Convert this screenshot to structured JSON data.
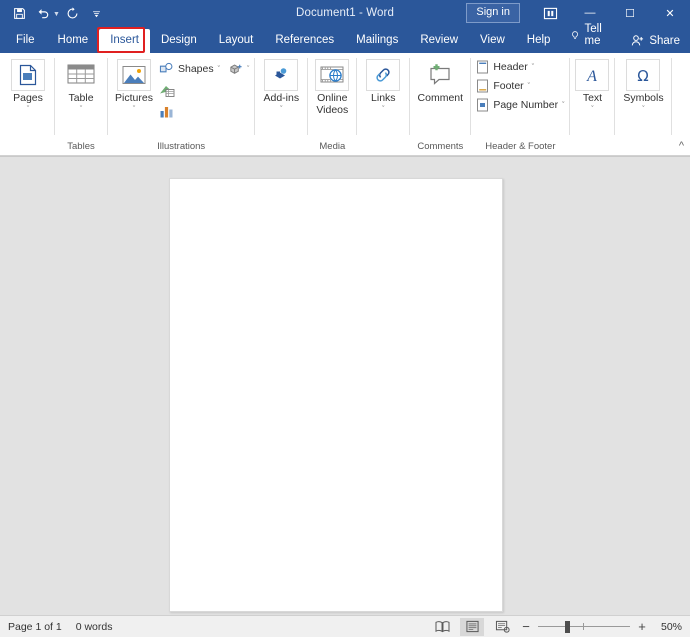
{
  "titlebar": {
    "document_title": "Document1  -  Word",
    "quick_access": [
      {
        "name": "save",
        "icon": "save-icon"
      },
      {
        "name": "undo",
        "icon": "undo-icon"
      },
      {
        "name": "redo",
        "icon": "redo-icon"
      },
      {
        "name": "customize-quick-access-toolbar",
        "icon": "caret-down-icon"
      }
    ],
    "sign_in_label": "Sign in",
    "ribbon_display_options": "ribbon-display-options-icon",
    "minimize_label": "—",
    "maximize_label": "☐",
    "close_label": "✕"
  },
  "tabs": [
    {
      "label": "File",
      "active": false
    },
    {
      "label": "Home",
      "active": false
    },
    {
      "label": "Insert",
      "active": true,
      "highlighted": true
    },
    {
      "label": "Design",
      "active": false
    },
    {
      "label": "Layout",
      "active": false
    },
    {
      "label": "References",
      "active": false
    },
    {
      "label": "Mailings",
      "active": false
    },
    {
      "label": "Review",
      "active": false
    },
    {
      "label": "View",
      "active": false
    },
    {
      "label": "Help",
      "active": false
    }
  ],
  "tellme_label": "Tell me",
  "share_label": "Share",
  "highlight_color": "#e02020",
  "accent_color": "#2b579a",
  "ribbon": {
    "groups": [
      {
        "label": "",
        "buttons": [
          {
            "label": "Pages",
            "caret": "ˇ",
            "icon": "cover-page-icon"
          }
        ]
      },
      {
        "label": "Tables",
        "buttons": [
          {
            "label": "Table",
            "caret": "ˇ",
            "icon": "table-icon"
          }
        ]
      },
      {
        "label": "Illustrations",
        "buttons": [
          {
            "label": "Pictures",
            "caret": "ˇ",
            "icon": "pictures-icon"
          }
        ],
        "small_buttons": [
          {
            "label": "Shapes",
            "caret": "ˇ",
            "icon": "shapes-icon"
          },
          {
            "label": "",
            "caret": "ˇ",
            "icon": "3d-models-icon"
          },
          {
            "label": "",
            "caret": "",
            "icon": "smartart-icon"
          },
          {
            "label": "",
            "caret": "",
            "icon": "chart-icon"
          }
        ]
      },
      {
        "label": "",
        "buttons": [
          {
            "label": "Add-ins",
            "caret": "ˇ",
            "icon": "add-ins-icon"
          }
        ]
      },
      {
        "label": "Media",
        "buttons": [
          {
            "label": "Online Videos",
            "caret": "",
            "icon": "online-videos-icon"
          }
        ]
      },
      {
        "label": "",
        "buttons": [
          {
            "label": "Links",
            "caret": "ˇ",
            "icon": "links-icon"
          }
        ]
      },
      {
        "label": "Comments",
        "buttons": [
          {
            "label": "Comment",
            "caret": "",
            "icon": "comment-icon"
          }
        ]
      },
      {
        "label": "Header & Footer",
        "small_buttons": [
          {
            "label": "Header",
            "caret": "ˇ",
            "icon": "header-icon"
          },
          {
            "label": "Footer",
            "caret": "ˇ",
            "icon": "footer-icon"
          },
          {
            "label": "Page Number",
            "caret": "ˇ",
            "icon": "page-number-icon"
          }
        ]
      },
      {
        "label": "",
        "buttons": [
          {
            "label": "Text",
            "caret": "ˇ",
            "icon": "text-box-icon"
          }
        ]
      },
      {
        "label": "",
        "buttons": [
          {
            "label": "Symbols",
            "caret": "ˇ",
            "icon": "symbols-icon"
          }
        ]
      }
    ],
    "collapse_label": "^"
  },
  "statusbar": {
    "page_indicator": "Page 1 of 1",
    "word_count": "0 words",
    "views": [
      {
        "name": "read-mode",
        "selected": false
      },
      {
        "name": "print-layout",
        "selected": true
      },
      {
        "name": "web-layout",
        "selected": false
      }
    ],
    "zoom_out_label": "−",
    "zoom_in_label": "+",
    "zoom_level": "50%"
  }
}
